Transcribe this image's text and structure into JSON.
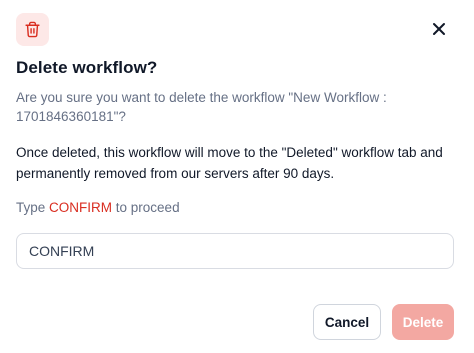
{
  "dialog": {
    "title": "Delete workflow?",
    "subtitle": "Are you sure you want to delete the workflow \"New Workflow : 1701846360181\"?",
    "body": "Once deleted, this workflow will move to the \"Deleted\" workflow tab and permanently removed from our servers after 90 days.",
    "instruction_prefix": "Type ",
    "instruction_keyword": "CONFIRM",
    "instruction_suffix": " to proceed",
    "input_value": "CONFIRM",
    "cancel_label": "Cancel",
    "delete_label": "Delete",
    "icons": {
      "header": "trash-icon",
      "close": "close-icon"
    },
    "colors": {
      "danger": "#d92d20",
      "danger_disabled": "#f3a8a2",
      "icon_badge_bg": "#fde8e7",
      "title": "#101828",
      "muted": "#667085"
    }
  }
}
